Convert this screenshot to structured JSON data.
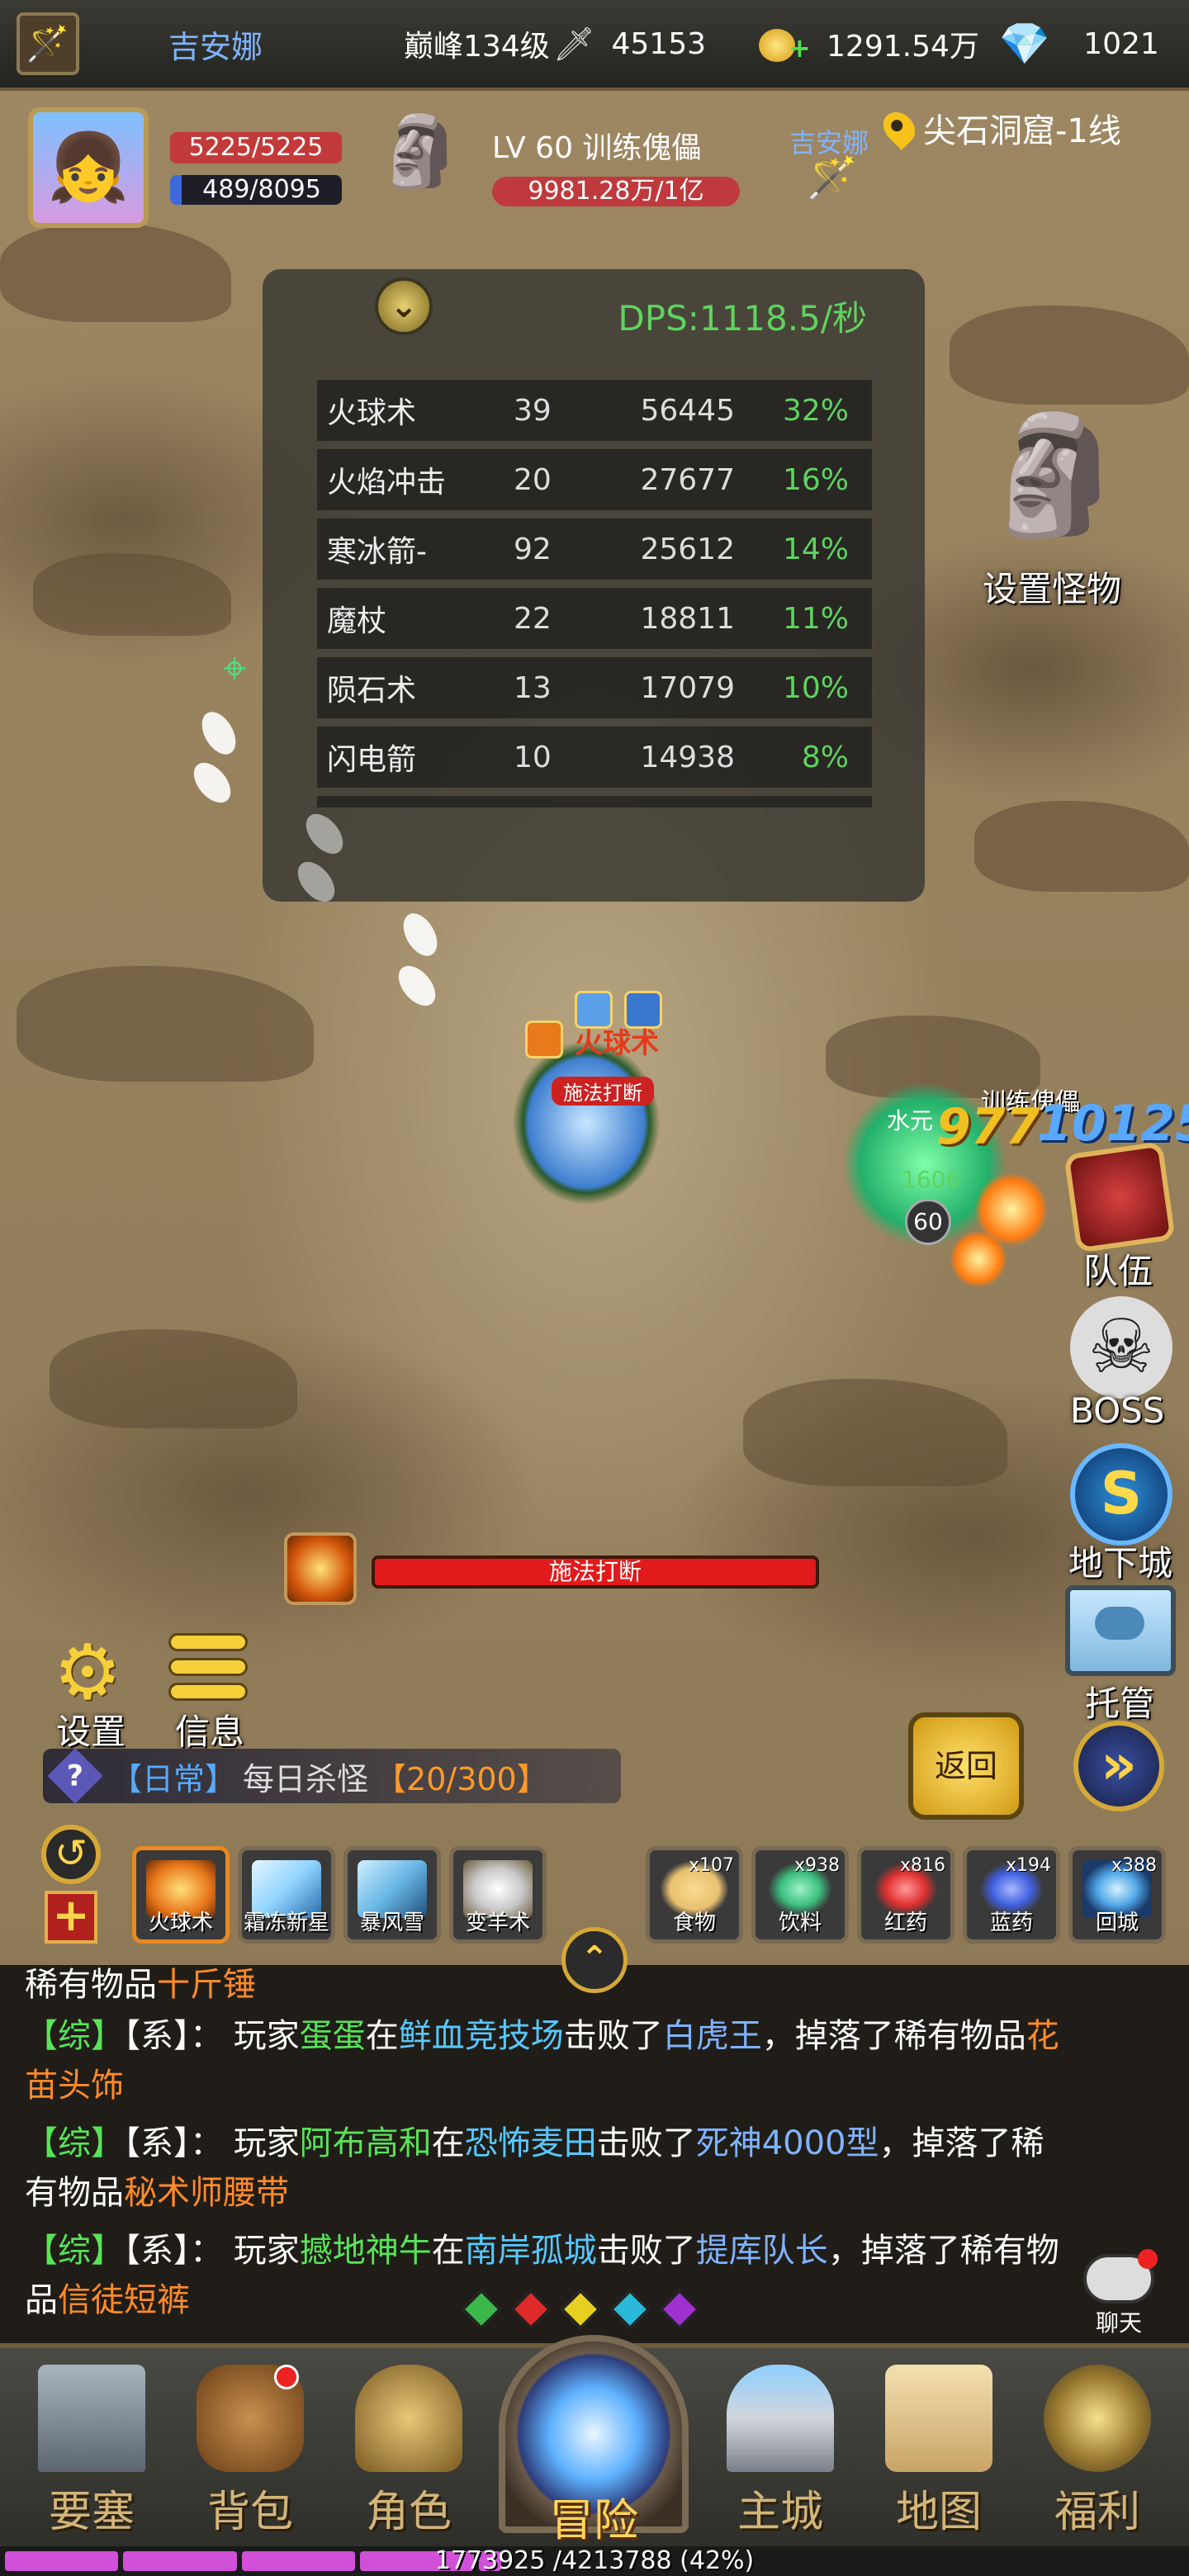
{
  "topbar": {
    "player_name": "吉安娜",
    "level": "巅峰134级",
    "power": "45153",
    "gold": "1291.54万",
    "diamonds": "1021"
  },
  "player": {
    "hp": "5225/5225",
    "mp": "489/8095"
  },
  "target": {
    "name": "LV 60 训练傀儡",
    "hp": "9981.28万/1亿",
    "owner": "吉安娜"
  },
  "location": "尖石洞窟-1线",
  "dps": {
    "title": "DPS:1118.5/秒",
    "rows": [
      {
        "skill": "火球术",
        "hits": "39",
        "damage": "56445",
        "pct": "32%"
      },
      {
        "skill": "火焰冲击",
        "hits": "20",
        "damage": "27677",
        "pct": "16%"
      },
      {
        "skill": "寒冰箭-",
        "hits": "92",
        "damage": "25612",
        "pct": "14%"
      },
      {
        "skill": "魔杖",
        "hits": "22",
        "damage": "18811",
        "pct": "11%"
      },
      {
        "skill": "陨石术",
        "hits": "13",
        "damage": "17079",
        "pct": "10%"
      },
      {
        "skill": "闪电箭",
        "hits": "10",
        "damage": "14938",
        "pct": "8%"
      }
    ]
  },
  "right_menu": {
    "set_monster": "设置怪物",
    "team": "队伍",
    "boss": "BOSS",
    "dungeon": "地下城",
    "auto": "托管"
  },
  "battle": {
    "hero_cast_label": "施法打断",
    "hero_skill_text": "火球术",
    "enemy_name": "训练傀儡",
    "enemy_prefix": "水元",
    "enemy_level": "60",
    "enemy_hp_small": "1606",
    "damage_text_1": "977",
    "damage_text_2": "10125"
  },
  "cast_bar": {
    "label": "施法打断"
  },
  "left_menu": {
    "settings": "设置",
    "info": "信息"
  },
  "quest": {
    "type": "【日常】",
    "name": "每日杀怪",
    "progress": "【20/300】"
  },
  "buttons": {
    "return": "返回",
    "fast_forward": "»"
  },
  "skills": [
    {
      "label": "火球术",
      "color": "#e8761a"
    },
    {
      "label": "霜冻新星",
      "color": "#8fd3ff"
    },
    {
      "label": "暴风雪",
      "color": "#6ab8e6"
    },
    {
      "label": "变羊术",
      "color": "#c9c9c9"
    }
  ],
  "items": [
    {
      "label": "食物",
      "qty": "x107",
      "color": "#e8c070"
    },
    {
      "label": "饮料",
      "qty": "x938",
      "color": "#3cc080"
    },
    {
      "label": "红药",
      "qty": "x816",
      "color": "#e03030"
    },
    {
      "label": "蓝药",
      "qty": "x194",
      "color": "#4060e0"
    },
    {
      "label": "回城",
      "qty": "x388",
      "color": "#50a8e8"
    }
  ],
  "chat": {
    "partial_line": "稀有物品十斤锤",
    "partial_prefix": "稀有物品",
    "partial_item": "十斤锤",
    "messages": [
      {
        "tag": "【综】",
        "sys": "【系】：",
        "text1": "玩家",
        "player": "蛋蛋",
        "at": "在",
        "place": "鲜血竞技场",
        "defeated": "击败了",
        "boss": "白虎王",
        "drop": "，掉落了稀有物品",
        "item": "花苗头饰"
      },
      {
        "tag": "【综】",
        "sys": "【系】：",
        "text1": "玩家",
        "player": "阿布高和",
        "at": "在",
        "place": "恐怖麦田",
        "defeated": "击败了",
        "boss": "死神4000型",
        "drop": "，掉落了稀有物品",
        "item": "秘术师腰带"
      },
      {
        "tag": "【综】",
        "sys": "【系】：",
        "text1": "玩家",
        "player": "撼地神牛",
        "at": "在",
        "place": "南岸孤城",
        "defeated": "击败了",
        "boss": "提库队长",
        "drop": "，掉落了稀有物品",
        "item": "信徒短裤"
      }
    ],
    "channel_colors": [
      "#3cb84a",
      "#e02a2a",
      "#e8d020",
      "#2ab8d8",
      "#a030d0"
    ],
    "chat_button": "聊天"
  },
  "nav": [
    {
      "label": "要塞"
    },
    {
      "label": "背包"
    },
    {
      "label": "角色"
    },
    {
      "label": "冒险"
    },
    {
      "label": "主城"
    },
    {
      "label": "地图"
    },
    {
      "label": "福利"
    }
  ],
  "exp": {
    "text": "1773925 /4213788 (42%)",
    "fraction": 0.42
  }
}
